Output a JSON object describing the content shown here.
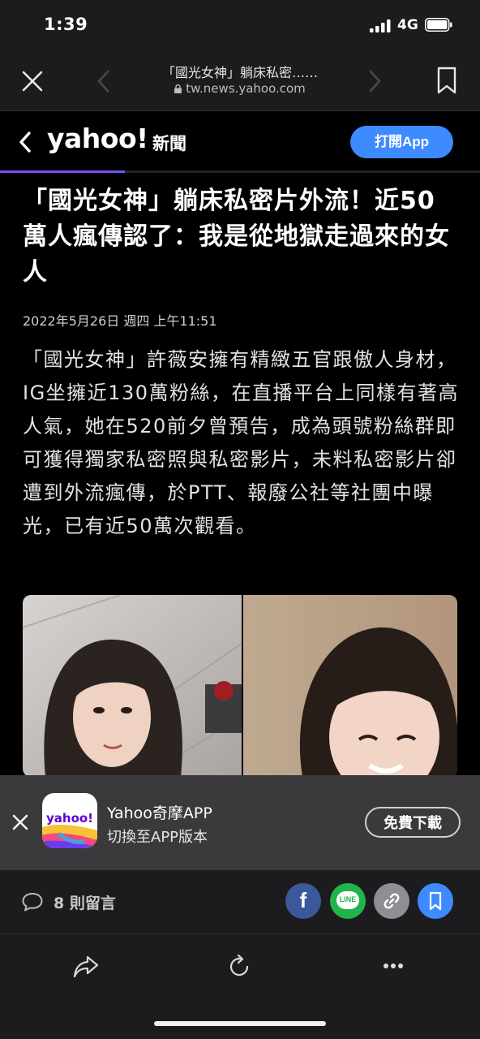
{
  "status_bar": {
    "time": "1:39",
    "network": "4G"
  },
  "browser": {
    "page_title": "「國光女神」躺床私密……",
    "url": "tw.news.yahoo.com"
  },
  "site_header": {
    "logo": "yahoo!",
    "section": "新聞",
    "open_app_label": "打開App",
    "accent_color": "#3d8bff",
    "progress_fraction": 0.26
  },
  "article": {
    "headline": "「國光女神」躺床私密片外流！近50萬人瘋傳認了：我是從地獄走過來的女人",
    "date": "2022年5月26日 週四 上午11:51",
    "body": "「國光女神」許薇安擁有精緻五官跟傲人身材，IG坐擁近130萬粉絲，在直播平台上同樣有著高人氣，她在520前夕曾預告，成為頭號粉絲群即可獲得獨家私密照與私密影片，未料私密影片卻遭到外流瘋傳，於PTT、報廢公社等社團中曝光，已有近50萬次觀看。"
  },
  "app_banner": {
    "icon_text": "yahoo!",
    "app_name": "Yahoo奇摩APP",
    "subtitle": "切換至APP版本",
    "download_label": "免費下載"
  },
  "share_bar": {
    "comments_label": "8 則留言",
    "buttons": [
      "facebook-icon",
      "line-icon",
      "link-icon",
      "bookmark-icon"
    ],
    "line_text": "LINE"
  }
}
